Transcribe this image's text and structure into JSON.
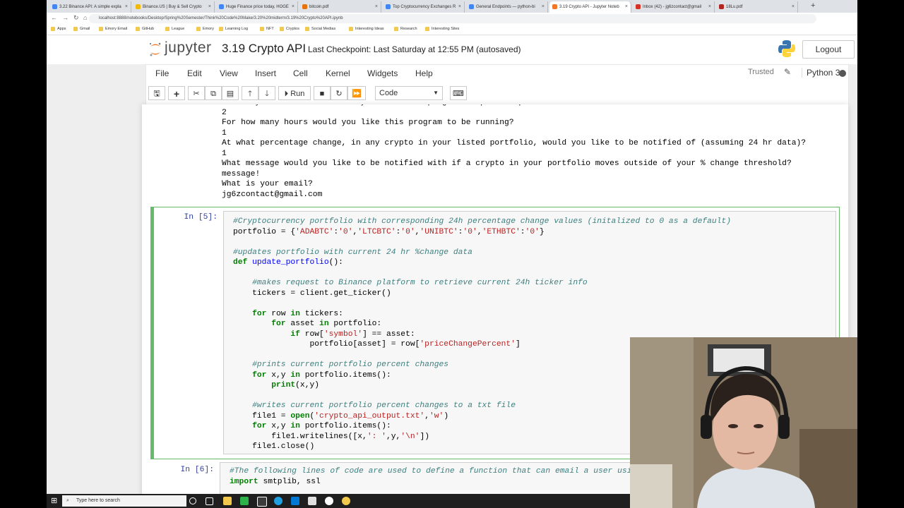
{
  "browser": {
    "tabs": [
      {
        "label": "3.22 Binance API: A simple expla",
        "color": "#4285f4"
      },
      {
        "label": "Binance.US | Buy & Sell Crypto",
        "color": "#f0b90b"
      },
      {
        "label": "Huge Finance price today, HOGE",
        "color": "#4285f4"
      },
      {
        "label": "bitcoin.pdf",
        "color": "#e8710a"
      },
      {
        "label": "Top Cryptocurrency Exchanges R",
        "color": "#4285f4"
      },
      {
        "label": "General Endpoints — python-bi",
        "color": "#4285f4"
      },
      {
        "label": "3.19 Crypto API - Jupyter Noteb",
        "color": "#f37726"
      },
      {
        "label": "Inbox (42) - jg6zcontact@gmail",
        "color": "#d93025"
      },
      {
        "label": "18Lu.pdf",
        "color": "#b3261e"
      }
    ],
    "url": "localhost:8888/notebooks/Desktop/Spring%20Semester/Think%20Code%20Make/3.20%20midterm/3.19%20Crypto%20API.ipynb",
    "bookmarks": [
      "Apps",
      "Gmail",
      "Emory Email",
      "GitHub",
      "League",
      "Emory",
      "Learning Log",
      "NFT",
      "Cryptos",
      "Social Medias",
      "Interesting Ideas",
      "Research",
      "Interesting Sites"
    ]
  },
  "jupyter": {
    "logo_text": "jupyter",
    "notebook_title": "3.19 Crypto API",
    "checkpoint": "Last Checkpoint: Last Saturday at 12:55 PM  (autosaved)",
    "logout_label": "Logout",
    "menu": [
      "File",
      "Edit",
      "View",
      "Insert",
      "Cell",
      "Kernel",
      "Widgets",
      "Help"
    ],
    "trusted": "Trusted",
    "kernel_name": "Python 3",
    "run_label": "Run",
    "cell_type": "Code"
  },
  "output_lines": [
    "How many market checks would you like this program to perform per hour?",
    "2",
    "For how many hours would you like this program to be running?",
    "1",
    "At what percentage change, in any crypto in your listed portfolio, would you like to be notified of (assuming 24 hr data)?",
    "1",
    "What message would you like to be notified with if a crypto in your portfolio moves outside of your % change threshold?",
    "message!",
    "What is your email?",
    "jg6zcontact@gmail.com"
  ],
  "cell5": {
    "prompt": "In [5]:",
    "lines": [
      "#Cryptocurrency portfolio with corresponding 24h percentage change values (initalized to 0 as a default)",
      "portfolio = {'ADABTC':'0','LTCBTC':'0','UNIBTC':'0','ETHBTC':'0'}",
      "",
      "#updates portfolio with current 24 hr %change data",
      "def update_portfolio():",
      "",
      "    #makes request to Binance platform to retrieve current 24h ticker info",
      "    tickers = client.get_ticker()",
      "",
      "    for row in tickers:",
      "        for asset in portfolio:",
      "            if row['symbol'] == asset:",
      "                portfolio[asset] = row['priceChangePercent']",
      "",
      "    #prints current portfolio percent changes",
      "    for x,y in portfolio.items():",
      "        print(x,y)",
      "",
      "    #writes current portfolio percent changes to a txt file",
      "    file1 = open('crypto_api_output.txt','w')",
      "    for x,y in portfolio.items():",
      "        file1.writelines([x,': ',y,'\\n'])",
      "    file1.close()"
    ]
  },
  "cell6": {
    "prompt": "In [6]:",
    "lines": [
      "#The following lines of code are used to define a function that can email a user using",
      "import smtplib, ssl"
    ]
  },
  "taskbar": {
    "search_placeholder": "Type here to search"
  }
}
